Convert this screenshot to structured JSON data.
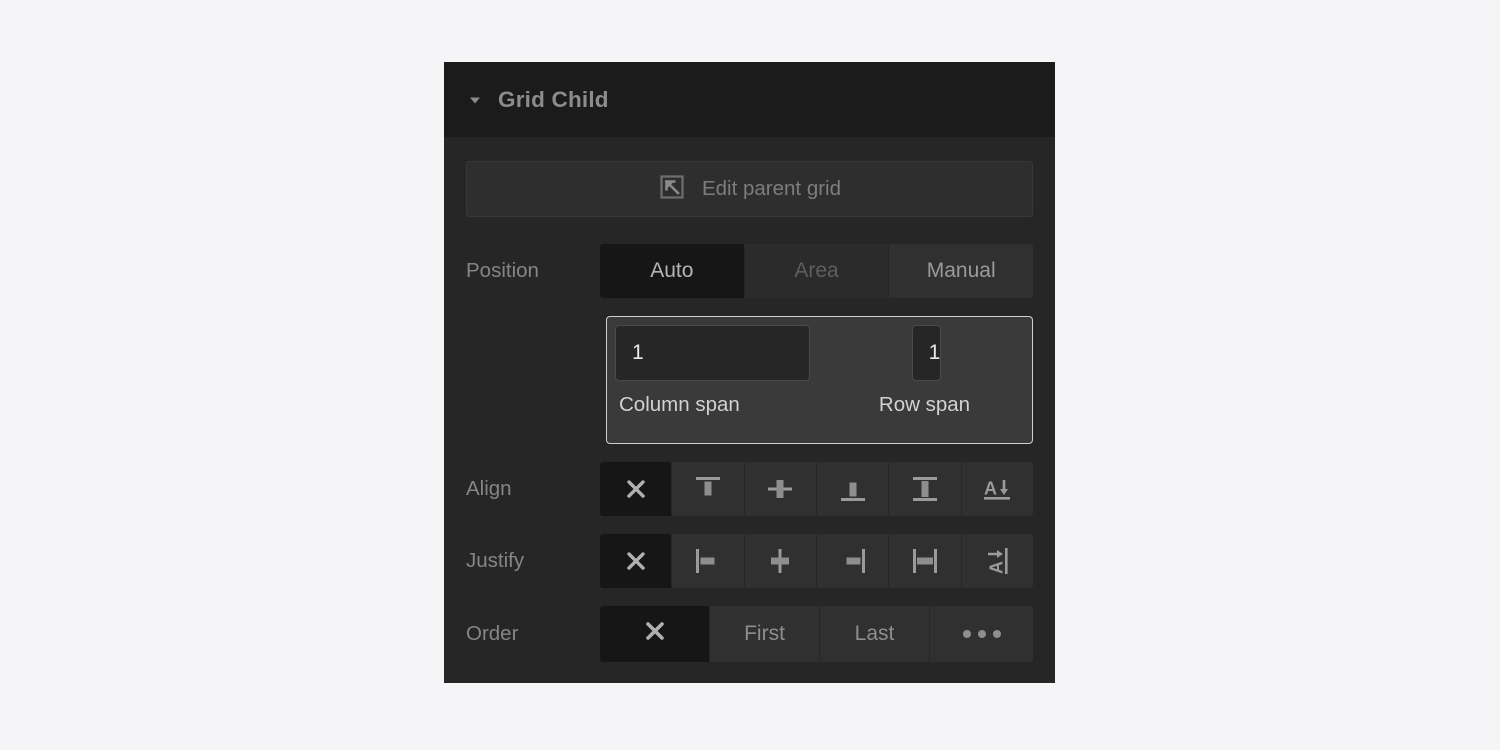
{
  "panel": {
    "title": "Grid Child",
    "disclosure_icon": "chevron-down-icon",
    "expanded": true
  },
  "edit_parent": {
    "label": "Edit parent grid",
    "icon": "arrow-up-left-in-square-icon"
  },
  "position": {
    "label": "Position",
    "options": [
      {
        "label": "Auto",
        "state": "selected"
      },
      {
        "label": "Area",
        "state": "disabled"
      },
      {
        "label": "Manual",
        "state": "normal"
      }
    ]
  },
  "span": {
    "focused": true,
    "column": {
      "value": "1",
      "caption": "Column span"
    },
    "row": {
      "value": "1",
      "caption": "Row span"
    }
  },
  "align": {
    "label": "Align",
    "options": [
      {
        "icon": "clear-x-icon",
        "state": "selected"
      },
      {
        "icon": "align-start-icon",
        "state": "normal"
      },
      {
        "icon": "align-center-icon",
        "state": "normal"
      },
      {
        "icon": "align-end-icon",
        "state": "normal"
      },
      {
        "icon": "align-stretch-icon",
        "state": "normal"
      },
      {
        "icon": "align-baseline-icon",
        "state": "normal"
      }
    ]
  },
  "justify": {
    "label": "Justify",
    "options": [
      {
        "icon": "clear-x-icon",
        "state": "selected"
      },
      {
        "icon": "justify-start-icon",
        "state": "normal"
      },
      {
        "icon": "justify-center-icon",
        "state": "normal"
      },
      {
        "icon": "justify-end-icon",
        "state": "normal"
      },
      {
        "icon": "justify-stretch-icon",
        "state": "normal"
      },
      {
        "icon": "justify-baseline-icon",
        "state": "normal"
      }
    ]
  },
  "order": {
    "label": "Order",
    "options": [
      {
        "label": "",
        "icon": "clear-x-icon",
        "state": "selected"
      },
      {
        "label": "First",
        "icon": null,
        "state": "normal"
      },
      {
        "label": "Last",
        "icon": null,
        "state": "normal"
      },
      {
        "label": "",
        "icon": "ellipsis-icon",
        "state": "normal"
      }
    ]
  },
  "colors": {
    "page_background": "#f5f5f7",
    "panel_background": "#262626",
    "header_background": "#1b1b1b",
    "control_background": "#303030",
    "selected_background": "#161616",
    "focus_ring": "#d0d0d0",
    "text_muted": "#858585",
    "text_bright": "#e8e8e8"
  }
}
